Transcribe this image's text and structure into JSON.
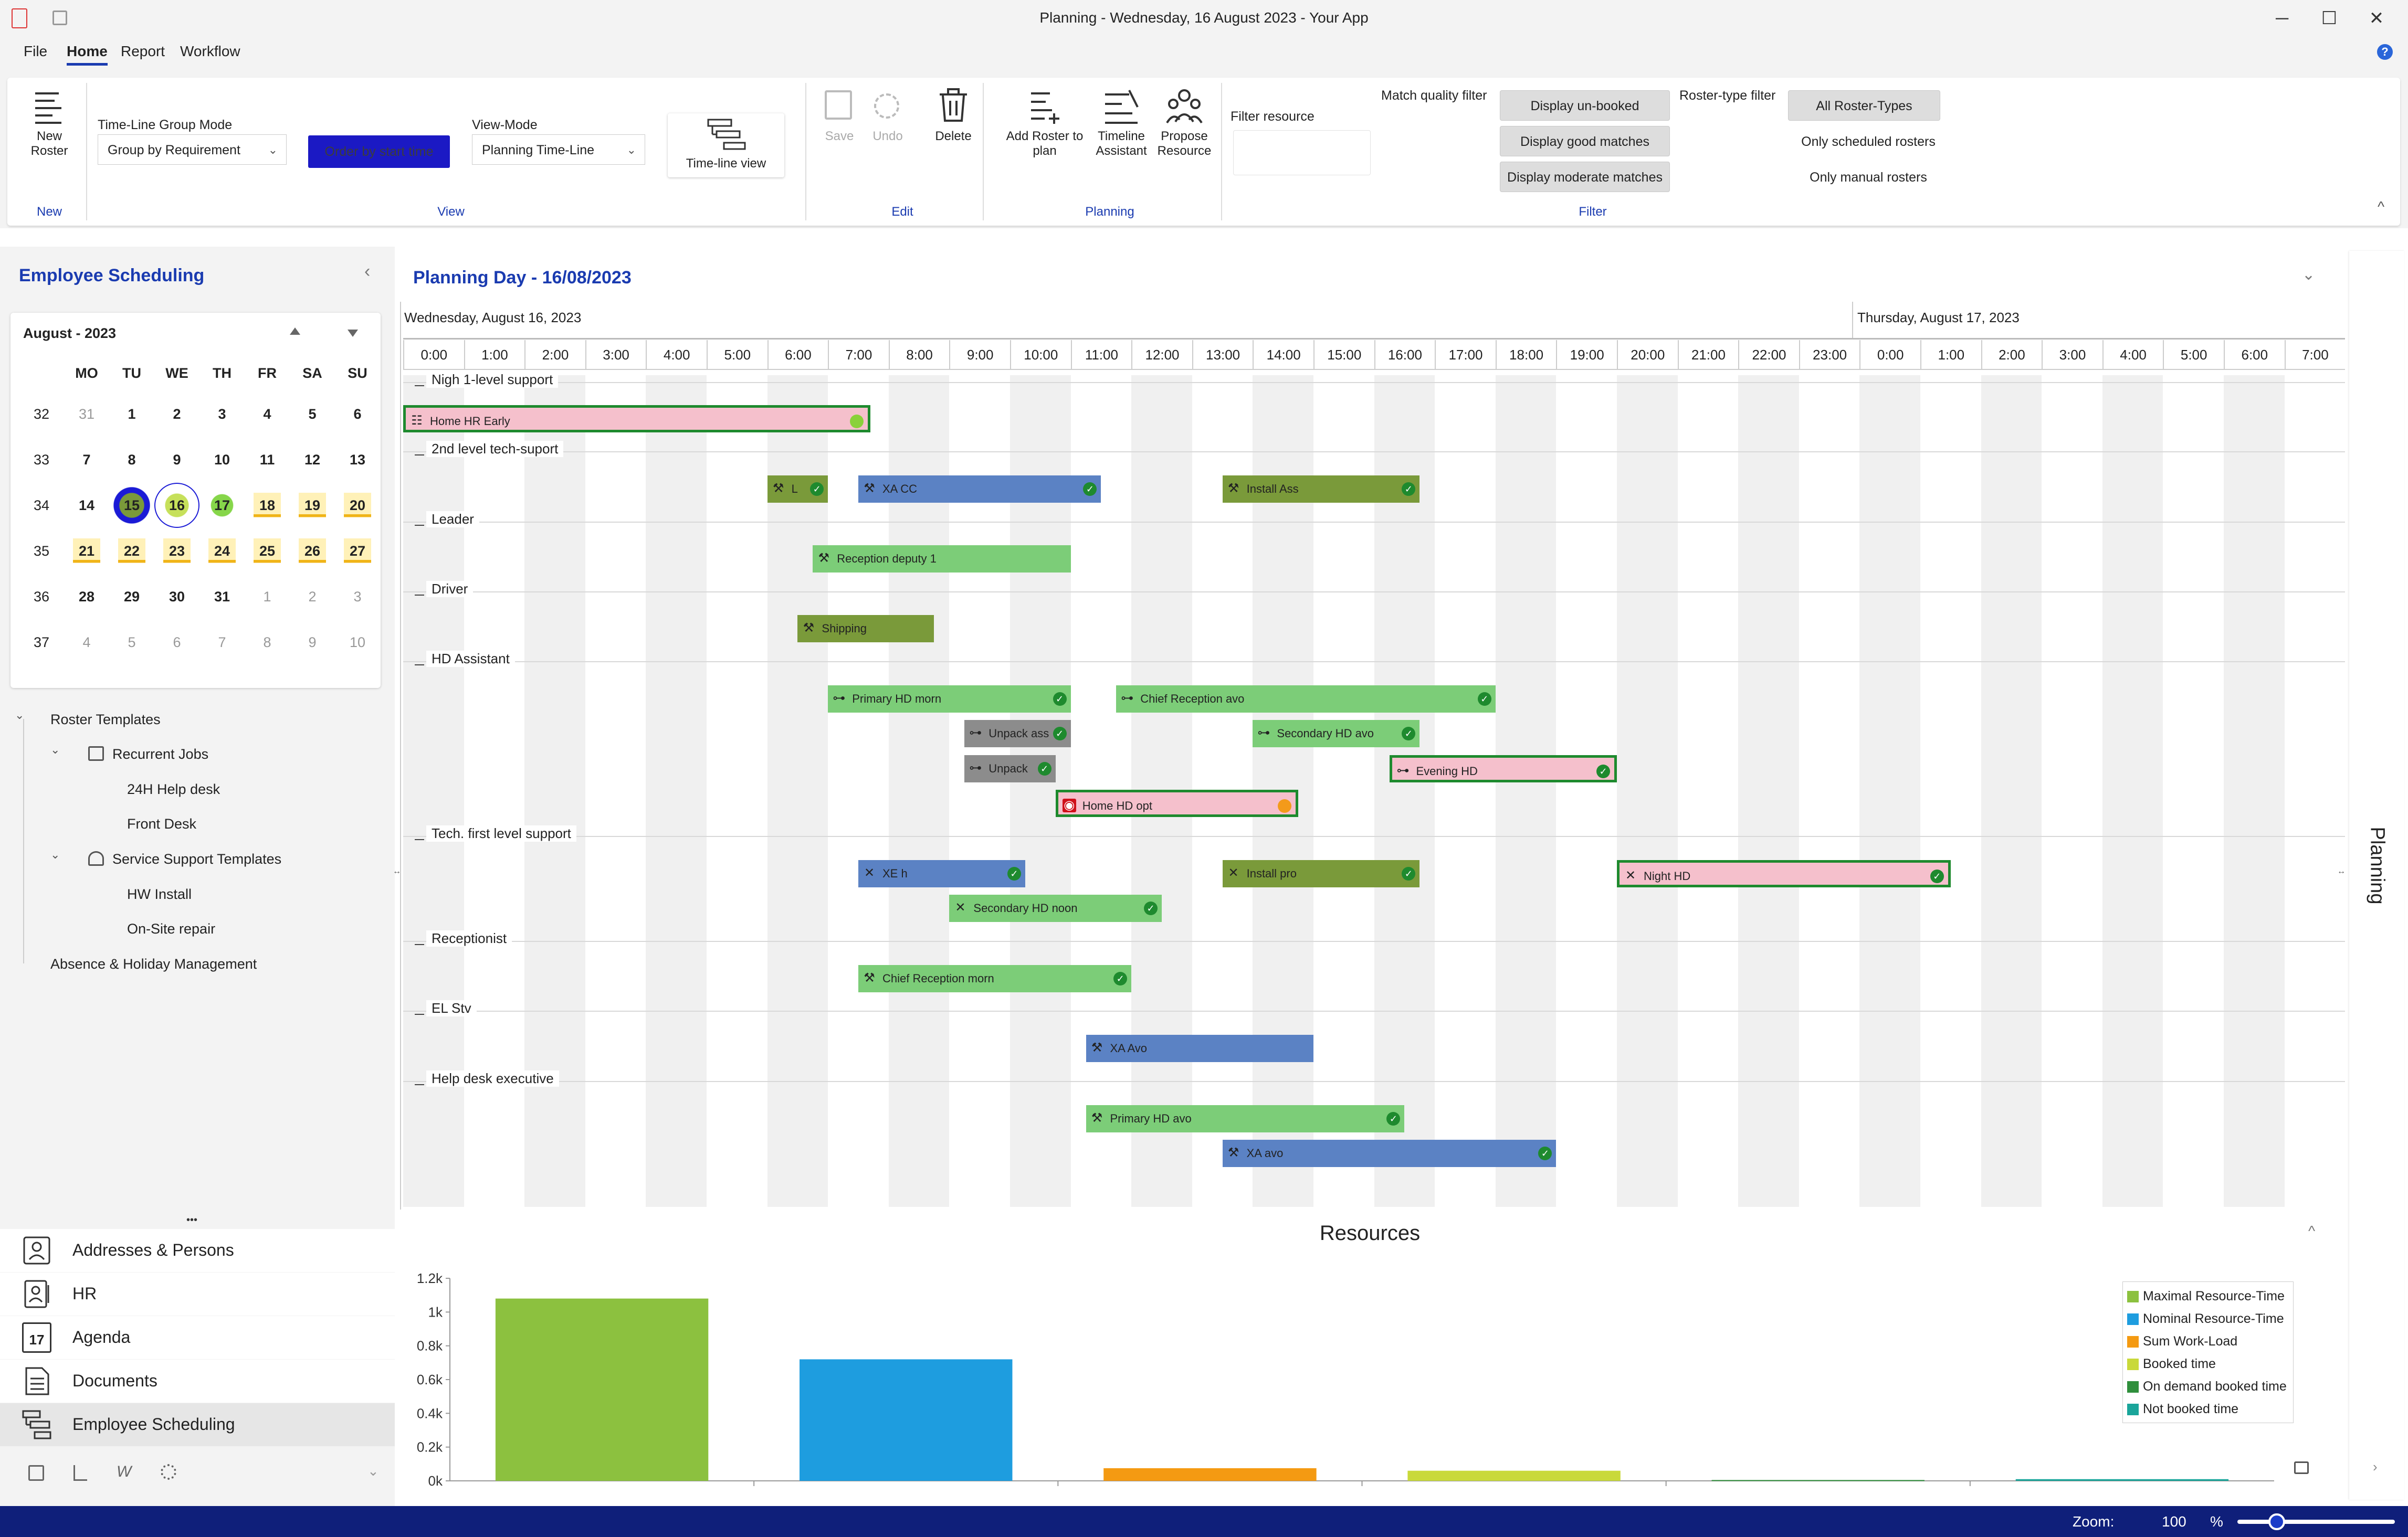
{
  "window": {
    "title": "Planning - Wednesday, 16 August 2023 - Your App",
    "minimize": "─",
    "maximize": "☐",
    "close": "✕"
  },
  "menu": {
    "items": [
      "File",
      "Home",
      "Report",
      "Workflow"
    ],
    "active": "Home",
    "help": "?"
  },
  "ribbon": {
    "new_roster": "New Roster",
    "group_new": "New",
    "timeline_group_mode_label": "Time-Line Group Mode",
    "timeline_group_mode_value": "Group by Requirement",
    "order_button": "Order by start time",
    "view_mode_label": "View-Mode",
    "view_mode_value": "Planning Time-Line",
    "timeline_view": "Time-line view",
    "group_view": "View",
    "save": "Save",
    "undo": "Undo",
    "delete": "Delete",
    "group_edit": "Edit",
    "add_roster": "Add Roster to plan",
    "timeline_assistant": "Timeline Assistant",
    "propose_resource": "Propose Resource",
    "group_planning": "Planning",
    "filter_resource_label": "Filter resource",
    "match_quality_label": "Match quality filter",
    "display_unbooked": "Display un-booked",
    "display_good": "Display good matches",
    "display_moderate": "Display moderate matches",
    "roster_type_label": "Roster-type filter",
    "all_roster_types": "All Roster-Types",
    "only_scheduled": "Only scheduled rosters",
    "only_manual": "Only manual rosters",
    "group_filter": "Filter",
    "collapse": "^"
  },
  "left": {
    "title": "Employee Scheduling",
    "collapse": "‹",
    "calendar": {
      "month": "August - 2023",
      "weekdays": [
        "MO",
        "TU",
        "WE",
        "TH",
        "FR",
        "SA",
        "SU"
      ],
      "weeks": [
        {
          "wk": "32",
          "days": [
            "31",
            "1",
            "2",
            "3",
            "4",
            "5",
            "6"
          ]
        },
        {
          "wk": "33",
          "days": [
            "7",
            "8",
            "9",
            "10",
            "11",
            "12",
            "13"
          ]
        },
        {
          "wk": "34",
          "days": [
            "14",
            "15",
            "16",
            "17",
            "18",
            "19",
            "20"
          ]
        },
        {
          "wk": "35",
          "days": [
            "21",
            "22",
            "23",
            "24",
            "25",
            "26",
            "27"
          ]
        },
        {
          "wk": "36",
          "days": [
            "28",
            "29",
            "30",
            "31",
            "1",
            "2",
            "3"
          ]
        },
        {
          "wk": "37",
          "days": [
            "4",
            "5",
            "6",
            "7",
            "8",
            "9",
            "10"
          ]
        }
      ]
    },
    "tree": {
      "roster_templates": "Roster Templates",
      "recurrent_jobs": "Recurrent Jobs",
      "help_desk": "24H Help desk",
      "front_desk": "Front Desk",
      "service_support": "Service Support Templates",
      "hw_install": "HW Install",
      "onsite_repair": "On-Site repair",
      "absence": "Absence & Holiday Management"
    },
    "nav": {
      "more": "•••",
      "items": [
        "Addresses & Persons",
        "HR",
        "Agenda",
        "Documents",
        "Employee Scheduling"
      ],
      "agenda_num": "17"
    }
  },
  "planner": {
    "title": "Planning Day - 16/08/2023",
    "day1": "Wednesday, August 16, 2023",
    "day2": "Thursday, August 17, 2023",
    "hours": [
      "0:00",
      "1:00",
      "2:00",
      "3:00",
      "4:00",
      "5:00",
      "6:00",
      "7:00",
      "8:00",
      "9:00",
      "10:00",
      "11:00",
      "12:00",
      "13:00",
      "14:00",
      "15:00",
      "16:00",
      "17:00",
      "18:00",
      "19:00",
      "20:00",
      "21:00",
      "22:00",
      "23:00",
      "0:00",
      "1:00",
      "2:00",
      "3:00",
      "4:00",
      "5:00",
      "6:00",
      "7:00"
    ],
    "groups": [
      {
        "label": "Nigh 1-level support",
        "y": 716
      },
      {
        "label": "2nd level tech-suport",
        "y": 848
      },
      {
        "label": "Leader",
        "y": 982
      },
      {
        "label": "Driver",
        "y": 1115
      },
      {
        "label": "HD Assistant",
        "y": 1248
      },
      {
        "label": "Tech. first level support",
        "y": 1581
      },
      {
        "label": "Receptionist",
        "y": 1781
      },
      {
        "label": "EL Stv",
        "y": 1914
      },
      {
        "label": "Help desk executive",
        "y": 2048
      }
    ],
    "bars": [
      {
        "label": "Home HR Early",
        "start": 0,
        "end": 7.7,
        "y": 772,
        "color": "pink",
        "icon": "people-icon",
        "sel": true,
        "dot": "#8ad13a"
      },
      {
        "label": "L",
        "start": 6,
        "end": 7,
        "y": 906,
        "color": "olive",
        "icon": "wrench-icon",
        "check": true
      },
      {
        "label": "XA CC",
        "start": 7.5,
        "end": 11.5,
        "y": 906,
        "color": "blue",
        "icon": "wrench-icon",
        "check": true
      },
      {
        "label": "Install Ass",
        "start": 13.5,
        "end": 16.75,
        "y": 906,
        "color": "olive",
        "icon": "wrench-icon",
        "check": true
      },
      {
        "label": "Reception deputy 1",
        "start": 6.75,
        "end": 11,
        "y": 1039,
        "color": "green",
        "icon": "wrench-icon"
      },
      {
        "label": "Shipping",
        "start": 6.5,
        "end": 8.75,
        "y": 1172,
        "color": "olive",
        "icon": "wrench-icon"
      },
      {
        "label": "Primary HD morn",
        "start": 7,
        "end": 11,
        "y": 1306,
        "color": "green",
        "icon": "link-icon",
        "check": true
      },
      {
        "label": "Chief Reception avo",
        "start": 11.75,
        "end": 18,
        "y": 1306,
        "color": "green",
        "icon": "link-icon",
        "check": true
      },
      {
        "label": "Unpack ass",
        "start": 9.25,
        "end": 11,
        "y": 1372,
        "color": "gray",
        "icon": "link-icon",
        "check": true
      },
      {
        "label": "Secondary HD avo",
        "start": 14,
        "end": 16.75,
        "y": 1372,
        "color": "green",
        "icon": "link-icon",
        "check": true
      },
      {
        "label": "Unpack",
        "start": 9.25,
        "end": 10.75,
        "y": 1439,
        "color": "gray",
        "icon": "link-icon",
        "check": true
      },
      {
        "label": "Evening HD",
        "start": 16.25,
        "end": 20,
        "y": 1439,
        "color": "pink",
        "icon": "link-icon",
        "check": true,
        "sel": true
      },
      {
        "label": "Home HD opt",
        "start": 10.75,
        "end": 14.75,
        "y": 1505,
        "color": "pink",
        "icon": "alert-icon",
        "sel": true,
        "dot": "#f39a1a"
      },
      {
        "label": "XE h",
        "start": 7.5,
        "end": 10.25,
        "y": 1639,
        "color": "blue",
        "icon": "tools-icon",
        "check": true
      },
      {
        "label": "Install pro",
        "start": 13.5,
        "end": 16.75,
        "y": 1639,
        "color": "olive",
        "icon": "tools-icon",
        "check": true
      },
      {
        "label": "Night HD",
        "start": 20,
        "end": 25.5,
        "y": 1639,
        "color": "pink",
        "icon": "tools-icon",
        "check": true,
        "sel": true
      },
      {
        "label": "Secondary HD noon",
        "start": 9,
        "end": 12.5,
        "y": 1705,
        "color": "green",
        "icon": "tools-icon",
        "check": true
      },
      {
        "label": "Chief Reception morn",
        "start": 7.5,
        "end": 12,
        "y": 1839,
        "color": "green",
        "icon": "wrench-icon",
        "check": true
      },
      {
        "label": "XA Avo",
        "start": 11.25,
        "end": 15,
        "y": 1972,
        "color": "blue",
        "icon": "wrench-icon"
      },
      {
        "label": "Primary HD avo",
        "start": 11.25,
        "end": 16.5,
        "y": 2106,
        "color": "green",
        "icon": "wrench-icon",
        "check": true
      },
      {
        "label": "XA avo",
        "start": 13.5,
        "end": 19,
        "y": 2172,
        "color": "blue",
        "icon": "wrench-icon",
        "check": true
      }
    ],
    "collapse": "⌄",
    "side_tab": "Planning"
  },
  "resources": {
    "title": "Resources",
    "collapse": "^",
    "chart_data": {
      "type": "bar",
      "title": "",
      "categories": [
        "Maximal Resource-Time",
        "Nominal Resource-Time",
        "Sum Work-Load",
        "Booked time",
        "On demand booked time",
        "Not booked time"
      ],
      "values": [
        1080,
        720,
        75,
        60,
        5,
        10
      ],
      "colors": [
        "#8cc13f",
        "#1e9ddf",
        "#f49a12",
        "#c9d93a",
        "#2f8f3c",
        "#1aa59a"
      ],
      "ylim": [
        0,
        1200
      ],
      "yticks": [
        "0k",
        "0.2k",
        "0.4k",
        "0.6k",
        "0.8k",
        "1k",
        "1.2k"
      ],
      "legend_position": "top-right"
    }
  },
  "status": {
    "zoom_label": "Zoom:",
    "zoom_value": "100",
    "zoom_unit": "%",
    "zoom_fraction": 0.25
  }
}
